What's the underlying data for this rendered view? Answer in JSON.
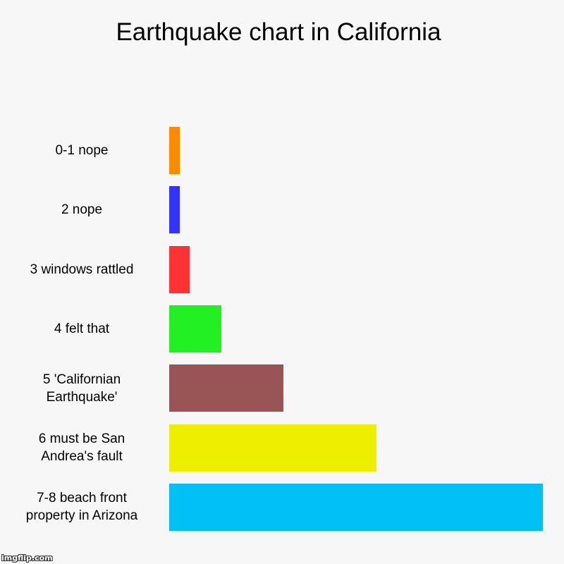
{
  "chart_data": {
    "type": "bar",
    "orientation": "horizontal",
    "title": "Earthquake chart in California",
    "xlabel": "",
    "ylabel": "",
    "grid": false,
    "categories": [
      "0-1 nope",
      "2 nope",
      "3 windows rattled",
      "4 felt that",
      "5 'Californian Earthquake'",
      "6 must be San Andrea's fault",
      "7-8 beach front property in Arizona"
    ],
    "values": [
      1,
      1,
      2,
      5,
      11,
      20,
      36
    ],
    "colors": [
      "#ff8a00",
      "#3333ff",
      "#ff3333",
      "#22f022",
      "#995555",
      "#eeee00",
      "#00c0f5"
    ],
    "xlim": [
      0,
      36
    ]
  },
  "watermark": "imgflip.com"
}
